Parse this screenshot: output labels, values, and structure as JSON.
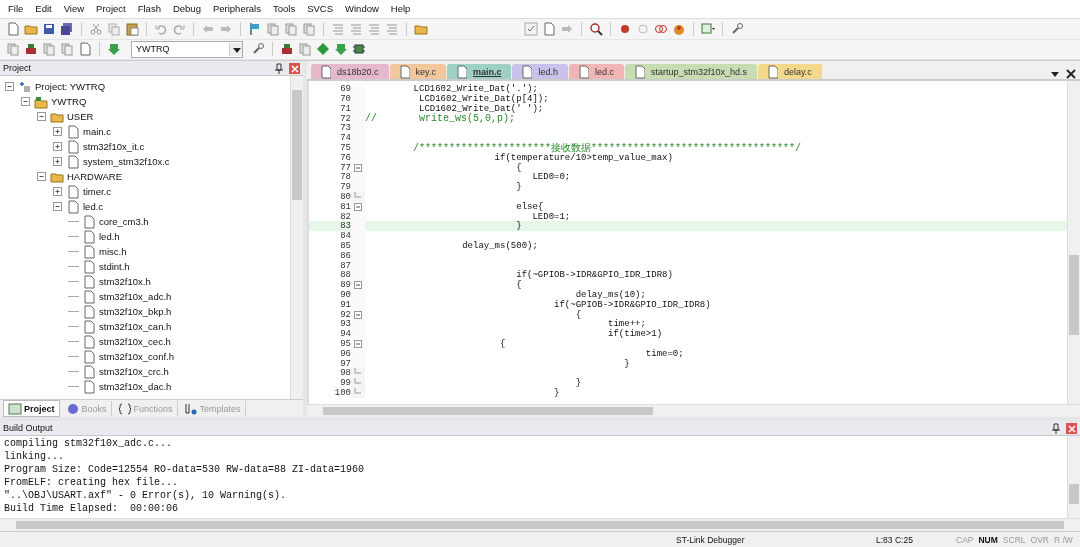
{
  "menu": [
    "File",
    "Edit",
    "View",
    "Project",
    "Flash",
    "Debug",
    "Peripherals",
    "Tools",
    "SVCS",
    "Window",
    "Help"
  ],
  "toolbar": {
    "target": "YWTRQ"
  },
  "project_panel": {
    "title": "Project",
    "tree": [
      {
        "label": "Project: YWTRQ",
        "kind": "project",
        "expanded": true,
        "children": [
          {
            "label": "YWTRQ",
            "kind": "target",
            "expanded": true,
            "children": [
              {
                "label": "USER",
                "kind": "group",
                "expanded": true,
                "children": [
                  {
                    "label": "main.c",
                    "kind": "file",
                    "expanded": false
                  },
                  {
                    "label": "stm32f10x_it.c",
                    "kind": "file",
                    "expanded": false
                  },
                  {
                    "label": "system_stm32f10x.c",
                    "kind": "file",
                    "expanded": false
                  }
                ]
              },
              {
                "label": "HARDWARE",
                "kind": "group",
                "expanded": true,
                "children": [
                  {
                    "label": "timer.c",
                    "kind": "file",
                    "expanded": false
                  },
                  {
                    "label": "led.c",
                    "kind": "file",
                    "expanded": true,
                    "children": [
                      {
                        "label": "core_cm3.h",
                        "kind": "header"
                      },
                      {
                        "label": "led.h",
                        "kind": "header"
                      },
                      {
                        "label": "misc.h",
                        "kind": "header"
                      },
                      {
                        "label": "stdint.h",
                        "kind": "header"
                      },
                      {
                        "label": "stm32f10x.h",
                        "kind": "header"
                      },
                      {
                        "label": "stm32f10x_adc.h",
                        "kind": "header"
                      },
                      {
                        "label": "stm32f10x_bkp.h",
                        "kind": "header"
                      },
                      {
                        "label": "stm32f10x_can.h",
                        "kind": "header"
                      },
                      {
                        "label": "stm32f10x_cec.h",
                        "kind": "header"
                      },
                      {
                        "label": "stm32f10x_conf.h",
                        "kind": "header"
                      },
                      {
                        "label": "stm32f10x_crc.h",
                        "kind": "header"
                      },
                      {
                        "label": "stm32f10x_dac.h",
                        "kind": "header"
                      }
                    ]
                  }
                ]
              }
            ]
          }
        ]
      }
    ],
    "tabs": [
      {
        "label": "Project",
        "selected": true
      },
      {
        "label": "Books",
        "selected": false
      },
      {
        "label": "Functions",
        "selected": false
      },
      {
        "label": "Templates",
        "selected": false
      }
    ]
  },
  "editor": {
    "tabs": [
      {
        "label": "ds18b20.c",
        "color": "#e6b8cc",
        "selected": false
      },
      {
        "label": "key.c",
        "color": "#f2c79c",
        "selected": false
      },
      {
        "label": "main.c",
        "color": "#9fd0c4",
        "selected": true
      },
      {
        "label": "led.h",
        "color": "#c9c1ea",
        "selected": false
      },
      {
        "label": "led.c",
        "color": "#f0b5b5",
        "selected": false
      },
      {
        "label": "startup_stm32f10x_hd.s",
        "color": "#c7dcb1",
        "selected": false
      },
      {
        "label": "delay.c",
        "color": "#f5d98b",
        "selected": false
      }
    ],
    "lines": [
      {
        "number": "69",
        "text": "         LCD1602_Write_Dat('.');",
        "kind": "code",
        "collapsible": false,
        "block_end": false,
        "current": false
      },
      {
        "number": "70",
        "text": "          LCD1602_Write_Dat(p[4]);",
        "kind": "code",
        "collapsible": false,
        "block_end": false,
        "current": false
      },
      {
        "number": "71",
        "text": "          LCD1602_Write_Dat(' ');",
        "kind": "code",
        "collapsible": false,
        "block_end": false,
        "current": false
      },
      {
        "number": "72",
        "text": "//       write_ws(5,0,p);",
        "kind": "comment",
        "collapsible": false,
        "block_end": false,
        "current": false
      },
      {
        "number": "73",
        "collapsible": false,
        "block_end": false,
        "current": false
      },
      {
        "number": "74",
        "collapsible": false,
        "block_end": false,
        "current": false
      },
      {
        "number": "75",
        "text": "        /**********************接收数据**********************************/",
        "kind": "comment",
        "collapsible": false,
        "block_end": false,
        "current": false
      },
      {
        "number": "76",
        "text": "                        if(temperature/10>temp_value_max)",
        "kind": "code",
        "collapsible": false,
        "block_end": false,
        "current": false
      },
      {
        "number": "77",
        "text": "                            {",
        "kind": "code",
        "collapsible": true,
        "block_end": false,
        "current": false
      },
      {
        "number": "78",
        "text": "                               LED0=0;",
        "kind": "code",
        "collapsible": false,
        "block_end": false,
        "current": false
      },
      {
        "number": "79",
        "text": "                            }",
        "kind": "code",
        "collapsible": false,
        "block_end": false,
        "current": false
      },
      {
        "number": "80",
        "collapsible": false,
        "block_end": true,
        "current": false
      },
      {
        "number": "81",
        "text": "                            else{",
        "kind": "code",
        "collapsible": true,
        "block_end": false,
        "current": false
      },
      {
        "number": "82",
        "text": "                               LED0=1;",
        "kind": "code",
        "collapsible": false,
        "block_end": false,
        "current": false
      },
      {
        "number": "83",
        "text": "                            }",
        "kind": "code",
        "collapsible": false,
        "block_end": false,
        "current": true
      },
      {
        "number": "84",
        "collapsible": false,
        "block_end": false,
        "current": false
      },
      {
        "number": "85",
        "text": "                  delay_ms(500);",
        "kind": "code",
        "collapsible": false,
        "block_end": false,
        "current": false
      },
      {
        "number": "86",
        "collapsible": false,
        "block_end": false,
        "current": false
      },
      {
        "number": "87",
        "collapsible": false,
        "block_end": false,
        "current": false
      },
      {
        "number": "88",
        "text": "                            if(~GPIOB->IDR&GPIO_IDR_IDR8)",
        "kind": "code",
        "collapsible": false,
        "block_end": false,
        "current": false
      },
      {
        "number": "89",
        "text": "                            {",
        "kind": "code",
        "collapsible": true,
        "block_end": false,
        "current": false
      },
      {
        "number": "90",
        "text": "                                       delay_ms(10);",
        "kind": "code",
        "collapsible": false,
        "block_end": false,
        "current": false
      },
      {
        "number": "91",
        "text": "                                   if(~GPIOB->IDR&GPIO_IDR_IDR8)",
        "kind": "code",
        "collapsible": false,
        "block_end": false,
        "current": false
      },
      {
        "number": "92",
        "text": "                                       {",
        "kind": "code",
        "collapsible": true,
        "block_end": false,
        "current": false
      },
      {
        "number": "93",
        "text": "                                             time++;",
        "kind": "code",
        "collapsible": false,
        "block_end": false,
        "current": false
      },
      {
        "number": "94",
        "text": "                                             if(time>1)",
        "kind": "code",
        "collapsible": false,
        "block_end": false,
        "current": false
      },
      {
        "number": "95",
        "text": "                         {",
        "kind": "code",
        "collapsible": true,
        "block_end": false,
        "current": false
      },
      {
        "number": "96",
        "text": "                                                    time=0;",
        "kind": "code",
        "collapsible": false,
        "block_end": false,
        "current": false
      },
      {
        "number": "97",
        "text": "                                                }",
        "kind": "code",
        "collapsible": false,
        "block_end": false,
        "current": false
      },
      {
        "number": "98",
        "collapsible": false,
        "block_end": true,
        "current": false
      },
      {
        "number": "99",
        "text": "                                       }",
        "kind": "code",
        "collapsible": false,
        "block_end": true,
        "current": false
      },
      {
        "number": "100",
        "text": "                                   }",
        "kind": "code",
        "collapsible": false,
        "block_end": true,
        "current": false
      }
    ]
  },
  "build_output": {
    "title": "Build Output",
    "lines": [
      "compiling stm32f10x_adc.c...",
      "linking...",
      "Program Size: Code=12554 RO-data=530 RW-data=88 ZI-data=1960",
      "FromELF: creating hex file...",
      "\"..\\OBJ\\USART.axf\" - 0 Error(s), 10 Warning(s).",
      "Build Time Elapsed:  00:00:06"
    ]
  },
  "status_bar": {
    "debugger": "ST-Link Debugger",
    "position": "L:83 C:25",
    "indicators": [
      {
        "label": "CAP",
        "on": false
      },
      {
        "label": "NUM",
        "on": true
      },
      {
        "label": "SCRL",
        "on": false
      },
      {
        "label": "OVR",
        "on": false
      },
      {
        "label": "R /W",
        "on": false
      }
    ]
  }
}
